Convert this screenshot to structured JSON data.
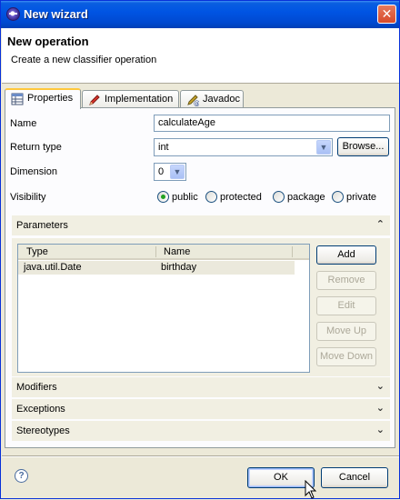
{
  "window": {
    "title": "New wizard",
    "close_glyph": "✕"
  },
  "banner": {
    "heading": "New operation",
    "description": "Create a new classifier operation"
  },
  "tabs": [
    {
      "label": "Properties",
      "icon": "table-icon",
      "active": true
    },
    {
      "label": "Implementation",
      "icon": "pen-icon",
      "active": false
    },
    {
      "label": "Javadoc",
      "icon": "javadoc-icon",
      "active": false
    }
  ],
  "form": {
    "name_label": "Name",
    "name_value": "calculateAge",
    "return_type_label": "Return type",
    "return_type_value": "int",
    "browse_label": "Browse...",
    "dimension_label": "Dimension",
    "dimension_value": "0",
    "visibility_label": "Visibility",
    "visibility_options": [
      "public",
      "protected",
      "package",
      "private"
    ],
    "visibility_selected": "public"
  },
  "parameters": {
    "title": "Parameters",
    "columns": [
      "Type",
      "Name"
    ],
    "rows": [
      {
        "type": "java.util.Date",
        "name": "birthday"
      }
    ],
    "buttons": {
      "add": "Add",
      "remove": "Remove",
      "edit": "Edit",
      "move_up": "Move Up",
      "move_down": "Move Down"
    }
  },
  "sections": [
    "Modifiers",
    "Exceptions",
    "Stereotypes"
  ],
  "footer": {
    "help_glyph": "?",
    "ok": "OK",
    "cancel": "Cancel"
  },
  "colors": {
    "titlebar": "#0054e3",
    "window_bg": "#ece9d8",
    "tab_highlight": "#ffc83c"
  }
}
